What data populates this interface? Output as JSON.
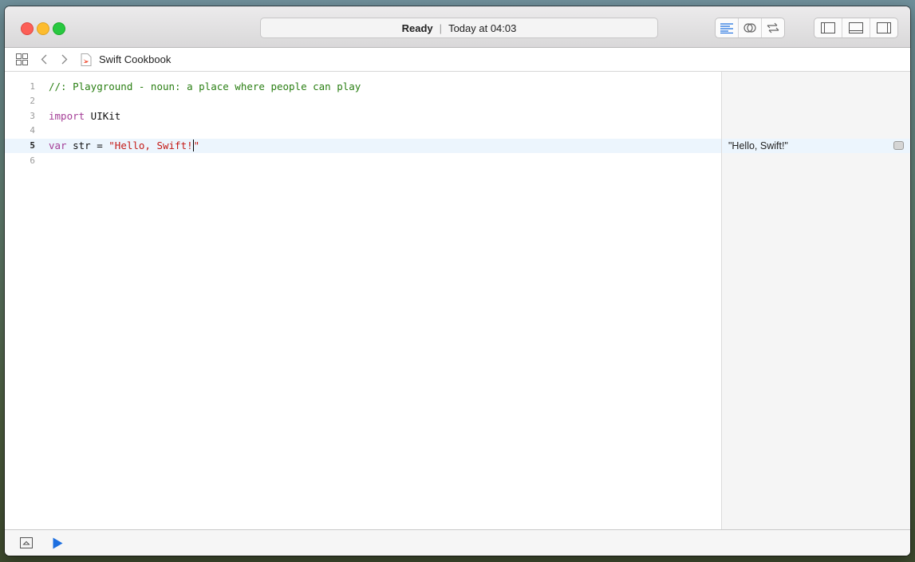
{
  "toolbar": {
    "status": "Ready",
    "timestamp": "Today at 04:03",
    "icons": [
      "editor-standard-icon",
      "editor-assistant-icon",
      "editor-version-icon",
      "navigator-toggle-icon",
      "debug-area-toggle-icon",
      "utilities-toggle-icon"
    ]
  },
  "jumpbar": {
    "file_name": "Swift Cookbook"
  },
  "editor": {
    "lines": [
      {
        "num": "1",
        "comment": "//: Playground - noun: a place where people can play"
      },
      {
        "num": "2"
      },
      {
        "num": "3",
        "keyword": "import",
        "rest": " UIKit"
      },
      {
        "num": "4"
      },
      {
        "num": "5",
        "keyword": "var",
        "plain": " str = ",
        "string": "\"Hello, Swift!\""
      },
      {
        "num": "6"
      }
    ],
    "current_line": 5
  },
  "results": {
    "line5": "\"Hello, Swift!\""
  },
  "colors": {
    "accent": "#1d6fe0",
    "keyword": "#a43d96",
    "comment": "#2a7f13",
    "string": "#c41a16"
  }
}
